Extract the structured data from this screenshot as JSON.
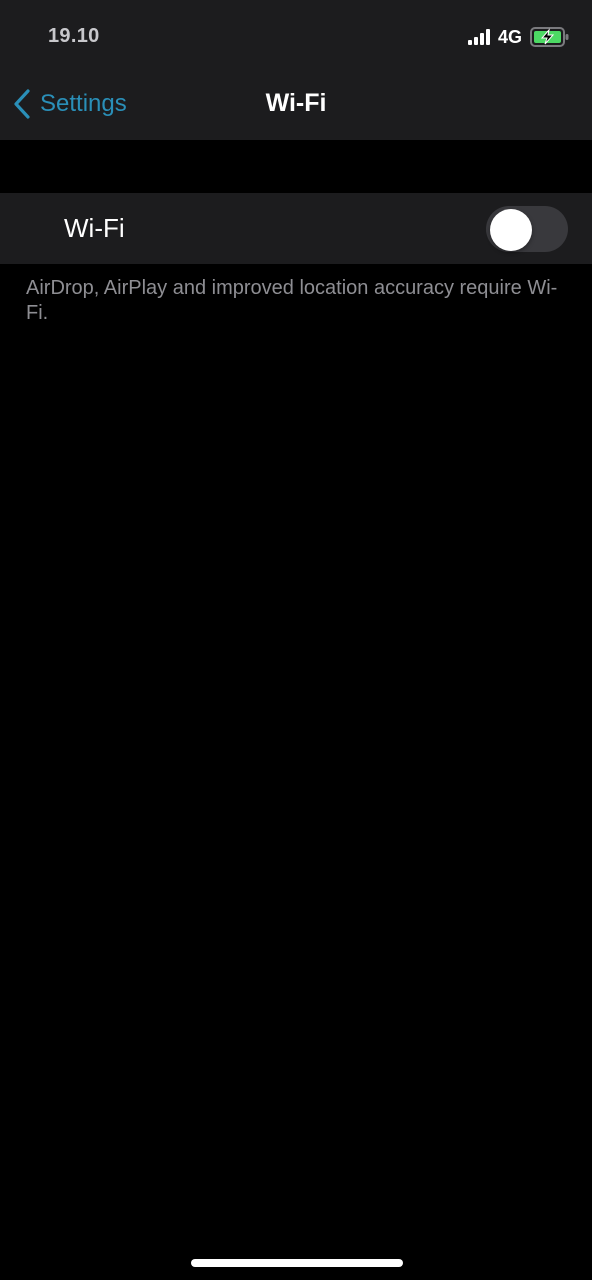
{
  "status_bar": {
    "time": "19.10",
    "network": "4G",
    "signal_bars": 4,
    "battery_charging": true,
    "battery_color": "#4cd964"
  },
  "nav": {
    "back_label": "Settings",
    "title": "Wi-Fi",
    "accent_color": "#2a8fb8"
  },
  "wifi_row": {
    "label": "Wi-Fi",
    "toggle_on": false
  },
  "footer_note": "AirDrop, AirPlay and improved location accuracy require Wi-Fi."
}
